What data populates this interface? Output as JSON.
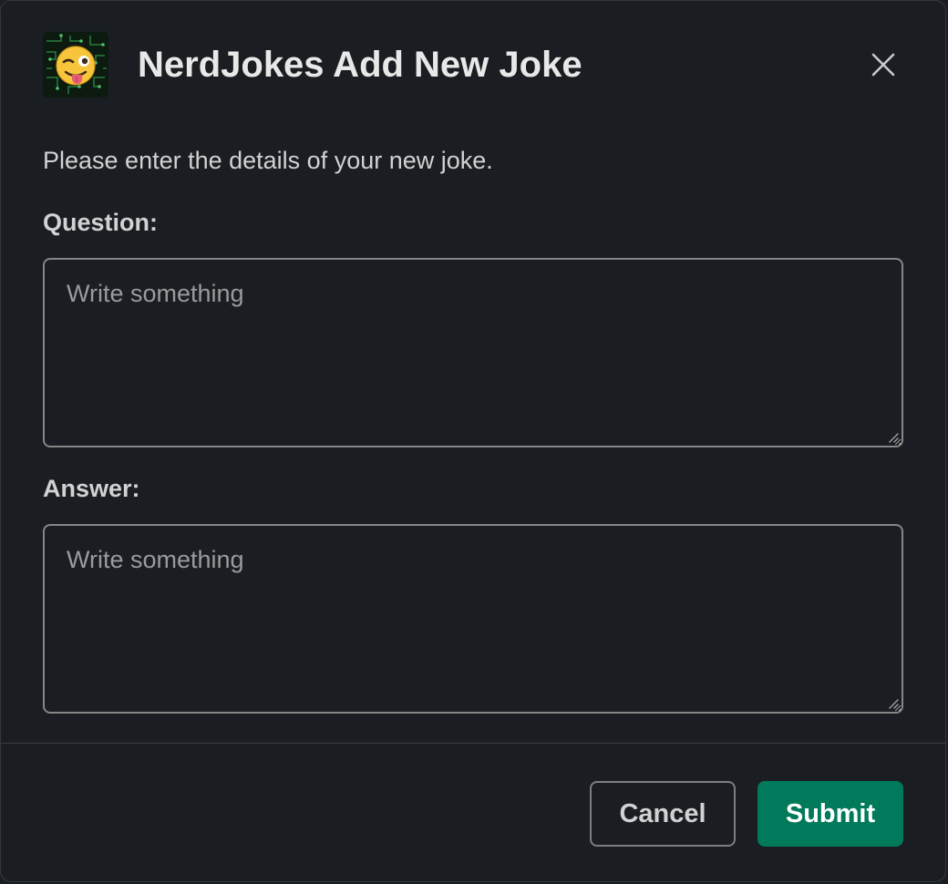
{
  "modal": {
    "app_icon": "winking-face-tongue-emoji-icon",
    "title": "NerdJokes Add New Joke",
    "close_icon": "close-icon",
    "intro": "Please enter the details of your new joke."
  },
  "form": {
    "question": {
      "label": "Question:",
      "placeholder": "Write something",
      "value": ""
    },
    "answer": {
      "label": "Answer:",
      "placeholder": "Write something",
      "value": ""
    }
  },
  "footer": {
    "cancel_label": "Cancel",
    "submit_label": "Submit"
  },
  "colors": {
    "background": "#1a1d21",
    "submit": "#007a5a",
    "field_border": "#868686"
  }
}
